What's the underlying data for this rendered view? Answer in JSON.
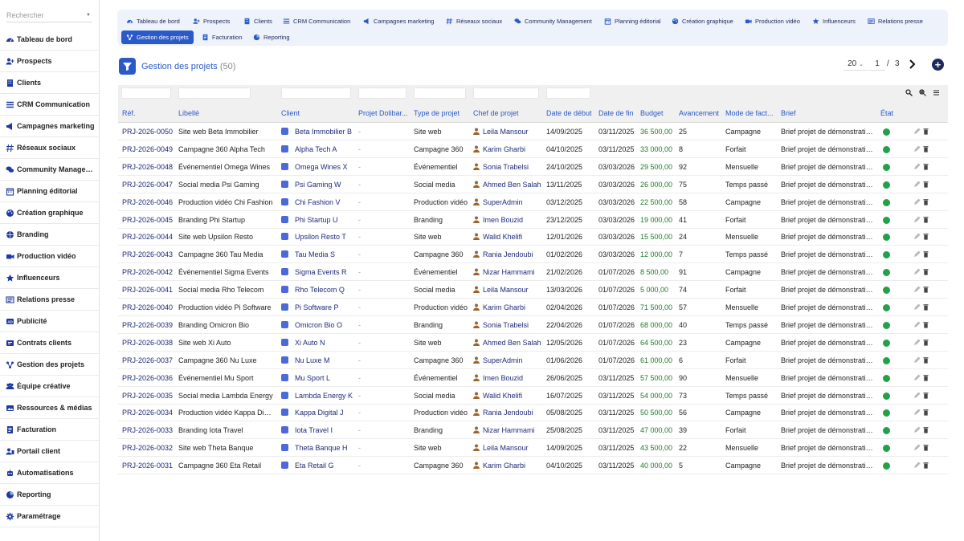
{
  "sidebar": {
    "search_placeholder": "Rechercher",
    "items": [
      {
        "label": "Tableau de bord",
        "icon": "dashboard-icon"
      },
      {
        "label": "Prospects",
        "icon": "user-plus-icon"
      },
      {
        "label": "Clients",
        "icon": "building-icon"
      },
      {
        "label": "CRM Communication",
        "icon": "bars-icon"
      },
      {
        "label": "Campagnes marketing",
        "icon": "megaphone-icon"
      },
      {
        "label": "Réseaux sociaux",
        "icon": "hashtag-icon"
      },
      {
        "label": "Community Management",
        "icon": "comments-icon"
      },
      {
        "label": "Planning éditorial",
        "icon": "calendar-icon"
      },
      {
        "label": "Création graphique",
        "icon": "palette-icon"
      },
      {
        "label": "Branding",
        "icon": "globe-icon"
      },
      {
        "label": "Production vidéo",
        "icon": "video-icon"
      },
      {
        "label": "Influenceurs",
        "icon": "star-icon"
      },
      {
        "label": "Relations presse",
        "icon": "newspaper-icon"
      },
      {
        "label": "Publicité",
        "icon": "ad-icon"
      },
      {
        "label": "Contrats clients",
        "icon": "contract-icon"
      },
      {
        "label": "Gestion des projets",
        "icon": "project-icon"
      },
      {
        "label": "Équipe créative",
        "icon": "team-icon"
      },
      {
        "label": "Ressources & médias",
        "icon": "media-icon"
      },
      {
        "label": "Facturation",
        "icon": "invoice-icon"
      },
      {
        "label": "Portail client",
        "icon": "portal-icon"
      },
      {
        "label": "Automatisations",
        "icon": "robot-icon"
      },
      {
        "label": "Reporting",
        "icon": "chart-pie-icon"
      },
      {
        "label": "Paramétrage",
        "icon": "gear-icon"
      }
    ]
  },
  "topnav": {
    "tabs": [
      {
        "label": "Tableau de bord",
        "icon": "dashboard-icon"
      },
      {
        "label": "Prospects",
        "icon": "user-plus-icon"
      },
      {
        "label": "Clients",
        "icon": "building-icon"
      },
      {
        "label": "CRM Communication",
        "icon": "bars-icon"
      },
      {
        "label": "Campagnes marketing",
        "icon": "megaphone-icon"
      },
      {
        "label": "Réseaux sociaux",
        "icon": "hashtag-icon"
      },
      {
        "label": "Community Management",
        "icon": "comments-icon"
      },
      {
        "label": "Planning éditorial",
        "icon": "calendar-icon"
      },
      {
        "label": "Création graphique",
        "icon": "palette-icon"
      },
      {
        "label": "Production vidéo",
        "icon": "video-icon"
      },
      {
        "label": "Influenceurs",
        "icon": "star-icon"
      },
      {
        "label": "Relations presse",
        "icon": "newspaper-icon"
      },
      {
        "label": "Gestion des projets",
        "icon": "project-icon",
        "active": true
      },
      {
        "label": "Facturation",
        "icon": "invoice-icon"
      },
      {
        "label": "Reporting",
        "icon": "chart-pie-icon"
      }
    ]
  },
  "page": {
    "title": "Gestion des projets",
    "count": "(50)"
  },
  "pagination": {
    "per_page": "20",
    "current": "1",
    "separator": "/",
    "total": "3"
  },
  "table": {
    "columns": [
      "Réf.",
      "Libellé",
      "Client",
      "Projet Dolibar...",
      "Type de projet",
      "Chef de projet",
      "Date de début",
      "Date de fin",
      "Budget",
      "Avancement",
      "Mode de fact...",
      "Brief",
      "État"
    ],
    "rows": [
      {
        "ref": "PRJ-2026-0050",
        "libelle": "Site web Beta Immobilier",
        "client": "Beta Immobilier B",
        "dolibarr": "-",
        "type": "Site web",
        "chef": "Leila Mansour",
        "debut": "14/09/2025",
        "fin": "03/11/2025",
        "budget": "36 500,00",
        "avancement": "25",
        "mode": "Campagne",
        "brief": "Brief projet de démonstration."
      },
      {
        "ref": "PRJ-2026-0049",
        "libelle": "Campagne 360 Alpha Tech",
        "client": "Alpha Tech A",
        "dolibarr": "-",
        "type": "Campagne 360",
        "chef": "Karim Gharbi",
        "debut": "04/10/2025",
        "fin": "03/11/2025",
        "budget": "33 000,00",
        "avancement": "8",
        "mode": "Forfait",
        "brief": "Brief projet de démonstration."
      },
      {
        "ref": "PRJ-2026-0048",
        "libelle": "Événementiel Omega Wines",
        "client": "Omega Wines X",
        "dolibarr": "-",
        "type": "Événementiel",
        "chef": "Sonia Trabelsi",
        "debut": "24/10/2025",
        "fin": "03/03/2026",
        "budget": "29 500,00",
        "avancement": "92",
        "mode": "Mensuelle",
        "brief": "Brief projet de démonstration."
      },
      {
        "ref": "PRJ-2026-0047",
        "libelle": "Social media Psi Gaming",
        "client": "Psi Gaming W",
        "dolibarr": "-",
        "type": "Social media",
        "chef": "Ahmed Ben Salah",
        "debut": "13/11/2025",
        "fin": "03/03/2026",
        "budget": "26 000,00",
        "avancement": "75",
        "mode": "Temps passé",
        "brief": "Brief projet de démonstration."
      },
      {
        "ref": "PRJ-2026-0046",
        "libelle": "Production vidéo Chi Fashion",
        "client": "Chi Fashion V",
        "dolibarr": "-",
        "type": "Production vidéo",
        "chef": "SuperAdmin",
        "debut": "03/12/2025",
        "fin": "03/03/2026",
        "budget": "22 500,00",
        "avancement": "58",
        "mode": "Campagne",
        "brief": "Brief projet de démonstration."
      },
      {
        "ref": "PRJ-2026-0045",
        "libelle": "Branding Phi Startup",
        "client": "Phi Startup U",
        "dolibarr": "-",
        "type": "Branding",
        "chef": "Imen Bouzid",
        "debut": "23/12/2025",
        "fin": "03/03/2026",
        "budget": "19 000,00",
        "avancement": "41",
        "mode": "Forfait",
        "brief": "Brief projet de démonstration."
      },
      {
        "ref": "PRJ-2026-0044",
        "libelle": "Site web Upsilon Resto",
        "client": "Upsilon Resto T",
        "dolibarr": "-",
        "type": "Site web",
        "chef": "Walid Khelifi",
        "debut": "12/01/2026",
        "fin": "03/03/2026",
        "budget": "15 500,00",
        "avancement": "24",
        "mode": "Mensuelle",
        "brief": "Brief projet de démonstration."
      },
      {
        "ref": "PRJ-2026-0043",
        "libelle": "Campagne 360 Tau Media",
        "client": "Tau Media S",
        "dolibarr": "-",
        "type": "Campagne 360",
        "chef": "Rania Jendoubi",
        "debut": "01/02/2026",
        "fin": "03/03/2026",
        "budget": "12 000,00",
        "avancement": "7",
        "mode": "Temps passé",
        "brief": "Brief projet de démonstration."
      },
      {
        "ref": "PRJ-2026-0042",
        "libelle": "Événementiel Sigma Events",
        "client": "Sigma Events R",
        "dolibarr": "-",
        "type": "Événementiel",
        "chef": "Nizar Hammami",
        "debut": "21/02/2026",
        "fin": "01/07/2026",
        "budget": "8 500,00",
        "avancement": "91",
        "mode": "Campagne",
        "brief": "Brief projet de démonstration."
      },
      {
        "ref": "PRJ-2026-0041",
        "libelle": "Social media Rho Telecom",
        "client": "Rho Telecom Q",
        "dolibarr": "-",
        "type": "Social media",
        "chef": "Leila Mansour",
        "debut": "13/03/2026",
        "fin": "01/07/2026",
        "budget": "5 000,00",
        "avancement": "74",
        "mode": "Forfait",
        "brief": "Brief projet de démonstration."
      },
      {
        "ref": "PRJ-2026-0040",
        "libelle": "Production vidéo Pi Software",
        "client": "Pi Software P",
        "dolibarr": "-",
        "type": "Production vidéo",
        "chef": "Karim Gharbi",
        "debut": "02/04/2026",
        "fin": "01/07/2026",
        "budget": "71 500,00",
        "avancement": "57",
        "mode": "Mensuelle",
        "brief": "Brief projet de démonstration."
      },
      {
        "ref": "PRJ-2026-0039",
        "libelle": "Branding Omicron Bio",
        "client": "Omicron Bio O",
        "dolibarr": "-",
        "type": "Branding",
        "chef": "Sonia Trabelsi",
        "debut": "22/04/2026",
        "fin": "01/07/2026",
        "budget": "68 000,00",
        "avancement": "40",
        "mode": "Temps passé",
        "brief": "Brief projet de démonstration."
      },
      {
        "ref": "PRJ-2026-0038",
        "libelle": "Site web Xi Auto",
        "client": "Xi Auto N",
        "dolibarr": "-",
        "type": "Site web",
        "chef": "Ahmed Ben Salah",
        "debut": "12/05/2026",
        "fin": "01/07/2026",
        "budget": "64 500,00",
        "avancement": "23",
        "mode": "Campagne",
        "brief": "Brief projet de démonstration."
      },
      {
        "ref": "PRJ-2026-0037",
        "libelle": "Campagne 360 Nu Luxe",
        "client": "Nu Luxe M",
        "dolibarr": "-",
        "type": "Campagne 360",
        "chef": "SuperAdmin",
        "debut": "01/06/2026",
        "fin": "01/07/2026",
        "budget": "61 000,00",
        "avancement": "6",
        "mode": "Forfait",
        "brief": "Brief projet de démonstration."
      },
      {
        "ref": "PRJ-2026-0036",
        "libelle": "Événementiel Mu Sport",
        "client": "Mu Sport L",
        "dolibarr": "-",
        "type": "Événementiel",
        "chef": "Imen Bouzid",
        "debut": "26/06/2025",
        "fin": "03/11/2025",
        "budget": "57 500,00",
        "avancement": "90",
        "mode": "Mensuelle",
        "brief": "Brief projet de démonstration."
      },
      {
        "ref": "PRJ-2026-0035",
        "libelle": "Social media Lambda Energy",
        "client": "Lambda Energy K",
        "dolibarr": "-",
        "type": "Social media",
        "chef": "Walid Khelifi",
        "debut": "16/07/2025",
        "fin": "03/11/2025",
        "budget": "54 000,00",
        "avancement": "73",
        "mode": "Temps passé",
        "brief": "Brief projet de démonstration."
      },
      {
        "ref": "PRJ-2026-0034",
        "libelle": "Production vidéo Kappa Digital",
        "client": "Kappa Digital J",
        "dolibarr": "-",
        "type": "Production vidéo",
        "chef": "Rania Jendoubi",
        "debut": "05/08/2025",
        "fin": "03/11/2025",
        "budget": "50 500,00",
        "avancement": "56",
        "mode": "Campagne",
        "brief": "Brief projet de démonstration."
      },
      {
        "ref": "PRJ-2026-0033",
        "libelle": "Branding Iota Travel",
        "client": "Iota Travel I",
        "dolibarr": "-",
        "type": "Branding",
        "chef": "Nizar Hammami",
        "debut": "25/08/2025",
        "fin": "03/11/2025",
        "budget": "47 000,00",
        "avancement": "39",
        "mode": "Forfait",
        "brief": "Brief projet de démonstration."
      },
      {
        "ref": "PRJ-2026-0032",
        "libelle": "Site web Theta Banque",
        "client": "Theta Banque H",
        "dolibarr": "-",
        "type": "Site web",
        "chef": "Leila Mansour",
        "debut": "14/09/2025",
        "fin": "03/11/2025",
        "budget": "43 500,00",
        "avancement": "22",
        "mode": "Mensuelle",
        "brief": "Brief projet de démonstration."
      },
      {
        "ref": "PRJ-2026-0031",
        "libelle": "Campagne 360 Eta Retail",
        "client": "Eta Retail G",
        "dolibarr": "-",
        "type": "Campagne 360",
        "chef": "Karim Gharbi",
        "debut": "04/10/2025",
        "fin": "03/11/2025",
        "budget": "40 000,00",
        "avancement": "5",
        "mode": "Campagne",
        "brief": "Brief projet de démonstration."
      }
    ]
  },
  "colors": {
    "accent": "#2a5ac8",
    "link": "#1e2a7a",
    "budget": "#1e7a2a",
    "status_active": "#22a04a",
    "nav_bg": "#eef2fb"
  }
}
